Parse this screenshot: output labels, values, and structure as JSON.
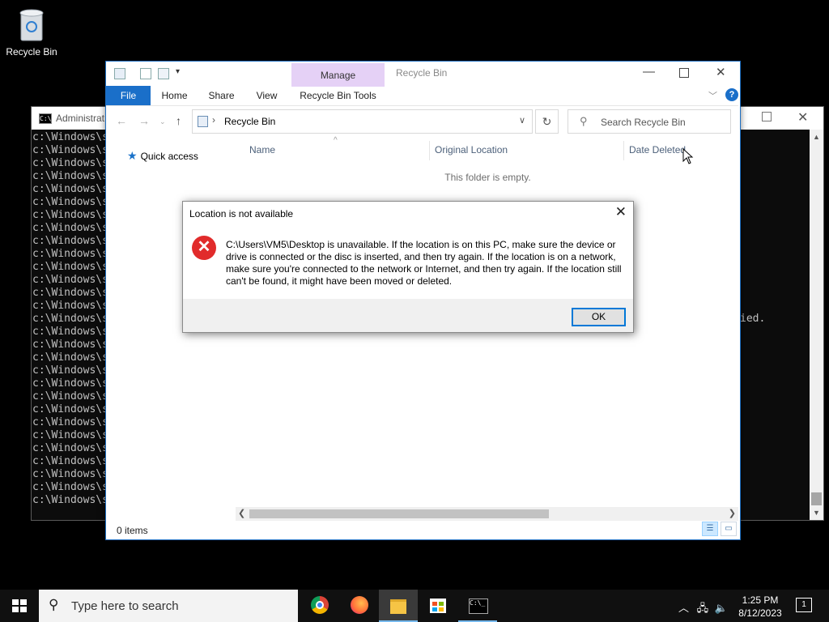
{
  "desktop": {
    "recycle_bin_label": "Recycle Bin"
  },
  "cmd": {
    "title": "Administrat",
    "line_text": "c:\\Windows\\s",
    "line_count": 29,
    "tail_text": "ied."
  },
  "explorer": {
    "title": "Recycle Bin",
    "manage_label": "Manage",
    "tabs": [
      "File",
      "Home",
      "Share",
      "View",
      "Recycle Bin Tools"
    ],
    "address": "Recycle Bin",
    "search_placeholder": "Search Recycle Bin",
    "nav_quick_access": "Quick access",
    "columns": [
      "Name",
      "Original Location",
      "Date Deleted"
    ],
    "empty_message": "This folder is empty.",
    "status": "0 items"
  },
  "dialog": {
    "title": "Location is not available",
    "message": "C:\\Users\\VM5\\Desktop is unavailable. If the location is on this PC, make sure the device or drive is connected or the disc is inserted, and then try again. If the location is on a network, make sure you're connected to the network or Internet, and then try again. If the location still can't be found, it might have been moved or deleted.",
    "ok_label": "OK"
  },
  "taskbar": {
    "search_placeholder": "Type here to search",
    "time": "1:25 PM",
    "date": "8/12/2023",
    "notification_count": "1"
  },
  "icons": {
    "error": "error-x-icon",
    "search": "magnifier-icon",
    "start": "windows-logo-icon"
  },
  "colors": {
    "accent": "#1a6fc9",
    "manage_tab": "#e5d1f6",
    "error": "#e12b2b",
    "taskbar": "#101010"
  }
}
